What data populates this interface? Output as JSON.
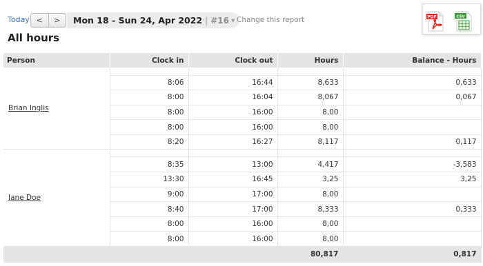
{
  "toolbar": {
    "today_label": "Today",
    "prev_label": "<",
    "next_label": ">",
    "date_range": "Mon 18 - Sun 24, Apr 2022",
    "separator": "|",
    "week_number": "#16",
    "change_report_label": "Change this report",
    "export": {
      "pdf_icon": "pdf-file-icon",
      "csv_icon": "csv-file-icon",
      "pdf_label": "PDF",
      "csv_label": "CSV"
    }
  },
  "page_title": "All hours",
  "table": {
    "columns": [
      "Person",
      "Clock in",
      "Clock out",
      "Hours",
      "Balance - Hours"
    ],
    "people": [
      {
        "name": "Brian Inglis",
        "rows": [
          {
            "clock_in": "8:06",
            "clock_out": "16:44",
            "hours": "8,633",
            "balance": "0,633"
          },
          {
            "clock_in": "8:00",
            "clock_out": "16:04",
            "hours": "8,067",
            "balance": "0,067"
          },
          {
            "clock_in": "8:00",
            "clock_out": "16:00",
            "hours": "8,00",
            "balance": ""
          },
          {
            "clock_in": "8:00",
            "clock_out": "16:00",
            "hours": "8,00",
            "balance": ""
          },
          {
            "clock_in": "8:20",
            "clock_out": "16:27",
            "hours": "8,117",
            "balance": "0,117"
          }
        ]
      },
      {
        "name": "Jane Doe",
        "rows": [
          {
            "clock_in": "8:35",
            "clock_out": "13:00",
            "hours": "4,417",
            "balance": "-3,583"
          },
          {
            "clock_in": "13:30",
            "clock_out": "16:45",
            "hours": "3,25",
            "balance": "3,25"
          },
          {
            "clock_in": "9:00",
            "clock_out": "17:00",
            "hours": "8,00",
            "balance": ""
          },
          {
            "clock_in": "8:40",
            "clock_out": "17:00",
            "hours": "8,333",
            "balance": "0,333"
          },
          {
            "clock_in": "8:00",
            "clock_out": "16:00",
            "hours": "8,00",
            "balance": ""
          },
          {
            "clock_in": "8:00",
            "clock_out": "16:00",
            "hours": "8,00",
            "balance": ""
          }
        ]
      }
    ],
    "totals": {
      "hours": "80,817",
      "balance": "0,817"
    }
  },
  "colors": {
    "link": "#3a73b4",
    "header_bg": "#e4e4e4",
    "grid": "#e3e3e3",
    "pdf_red": "#d9261c",
    "csv_green": "#3d9a3a"
  }
}
